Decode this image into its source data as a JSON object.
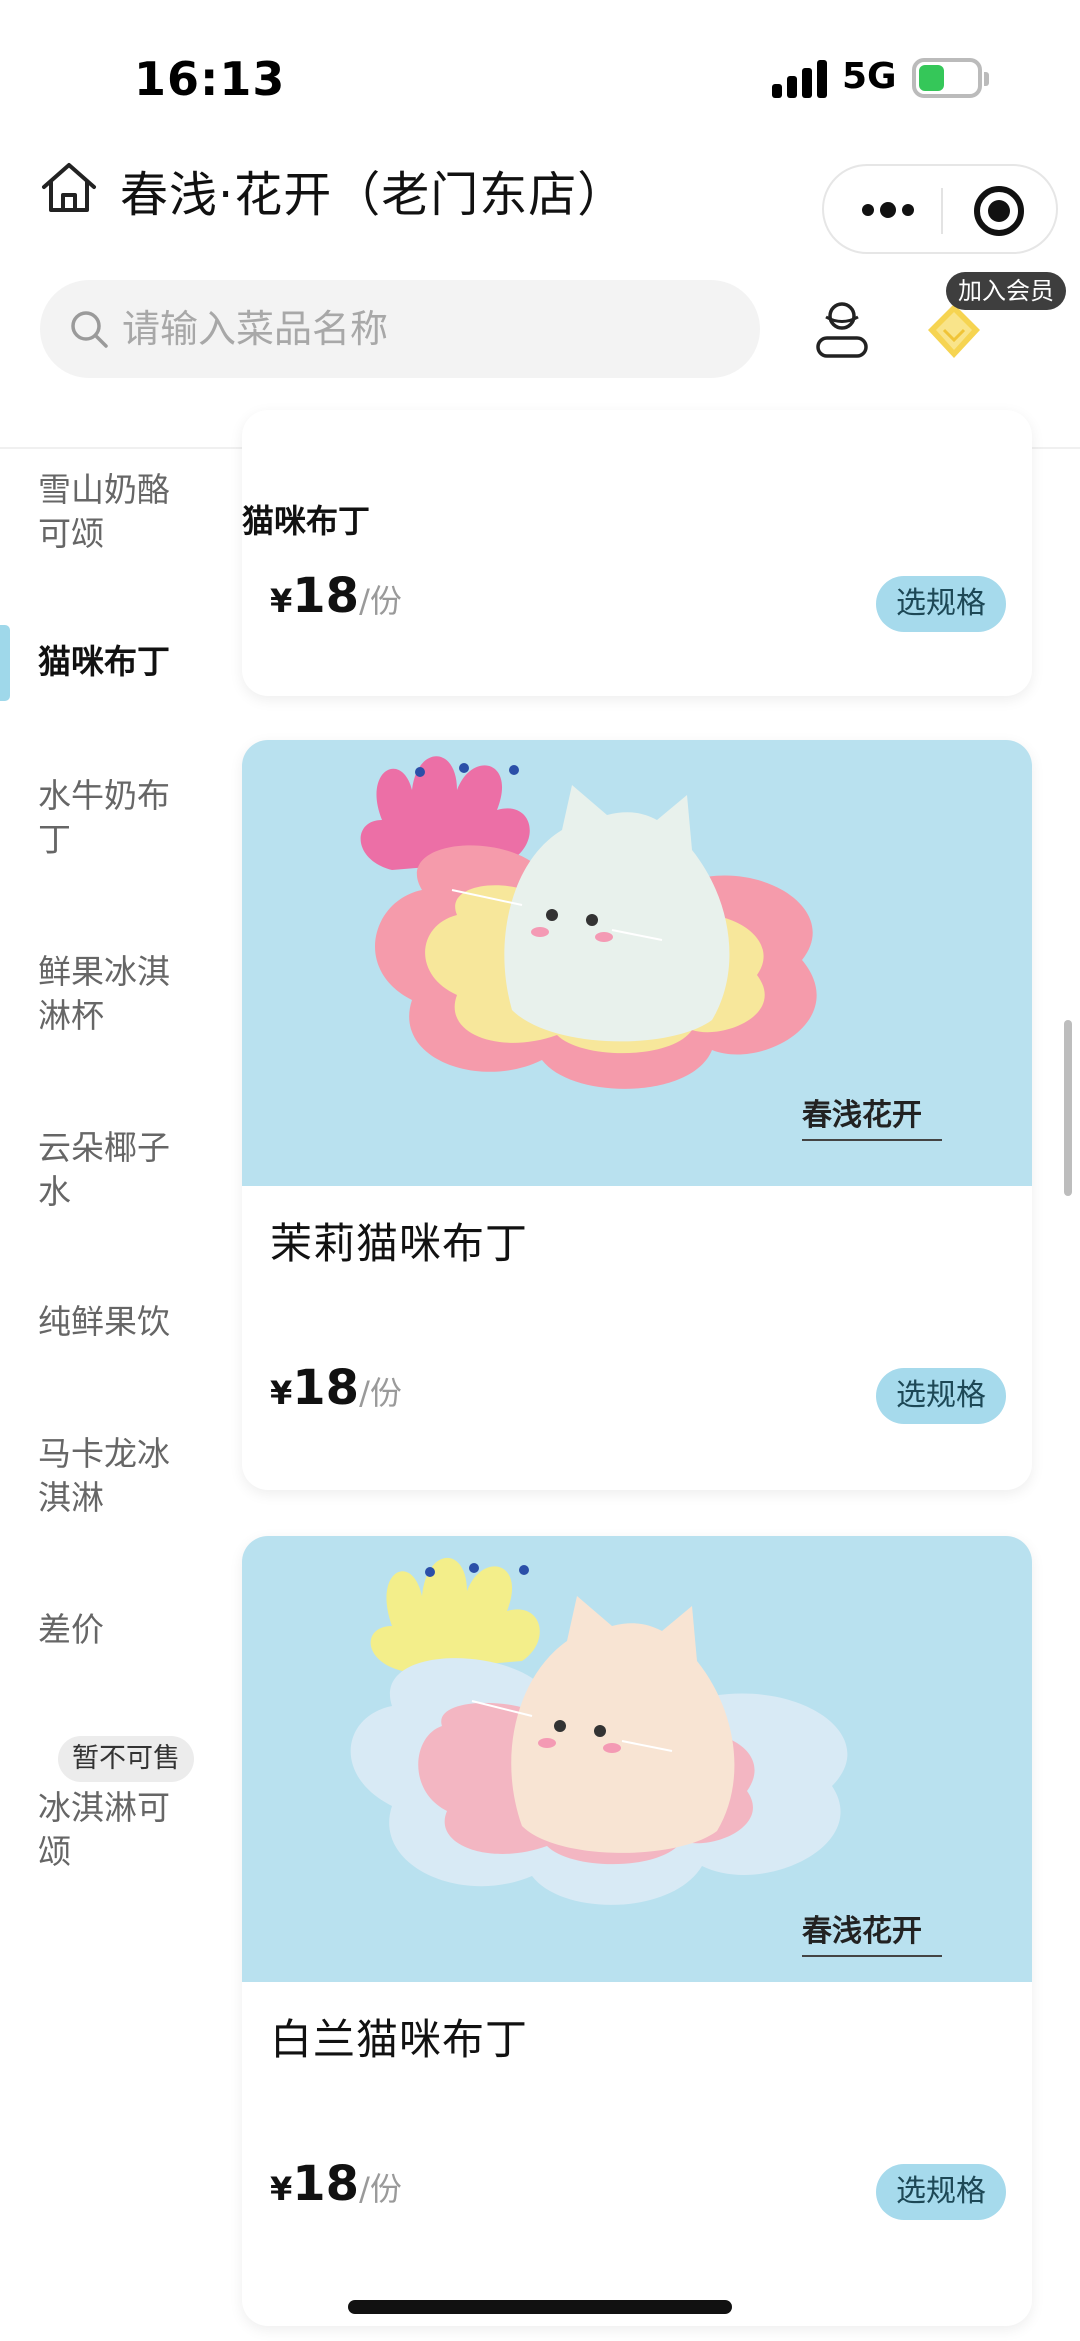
{
  "status_bar": {
    "time": "16:13",
    "network": "5G",
    "battery_level": 0.45,
    "battery_color": "#35c759"
  },
  "header": {
    "store_title": "春浅·花开（老门东店）",
    "capsule_icons": [
      "more-dots-icon",
      "close-target-icon"
    ]
  },
  "search": {
    "placeholder": "请输入菜品名称",
    "value": ""
  },
  "member": {
    "join_label": "加入会员",
    "icons": [
      "user-icon",
      "vip-diamond-icon"
    ]
  },
  "sidebar": {
    "active_index": 1,
    "accent_color": "#9fd8ea",
    "items": [
      {
        "label": "雪山奶酪可颂"
      },
      {
        "label": "猫咪布丁"
      },
      {
        "label": "水牛奶布丁"
      },
      {
        "label": "鲜果冰淇淋杯"
      },
      {
        "label": "云朵椰子水"
      },
      {
        "label": "纯鲜果饮"
      },
      {
        "label": "马卡龙冰淇淋"
      },
      {
        "label": "差价"
      },
      {
        "label": "冰淇淋可颂",
        "badge": "暂不可售"
      }
    ]
  },
  "main": {
    "section_title": "猫咪布丁",
    "products": [
      {
        "name": "",
        "price_symbol": "¥",
        "price": "18",
        "unit": "/份",
        "button": "选规格",
        "partial": true
      },
      {
        "name": "茉莉猫咪布丁",
        "price_symbol": "¥",
        "price": "18",
        "unit": "/份",
        "button": "选规格",
        "image_brand": "春浅花开",
        "flower_color": "#ec6fa6",
        "tray_color": "#f59bab"
      },
      {
        "name": "白兰猫咪布丁",
        "price_symbol": "¥",
        "price": "18",
        "unit": "/份",
        "button": "选规格",
        "image_brand": "春浅花开",
        "flower_color": "#f3ee8a",
        "tray_color": "#d8eaf5"
      }
    ]
  },
  "colors": {
    "button_bg": "#a6daec",
    "image_bg": "#b9e1ef"
  }
}
